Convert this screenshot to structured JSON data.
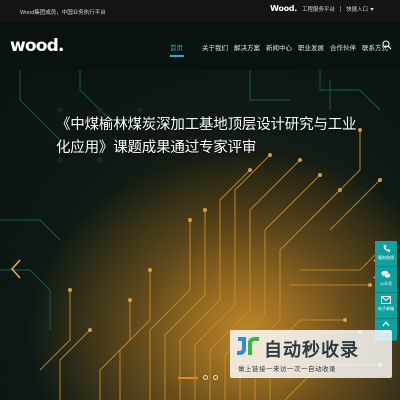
{
  "topbar": {
    "left_text": "Wood集团成员，中国业务执行平台",
    "mini_logo": "Wood.",
    "engineering_link": "工程服务平台",
    "quick_entry": "快捷入口"
  },
  "nav": {
    "logo": "wood.",
    "items": [
      {
        "label": "首页",
        "active": true
      },
      {
        "label": "关于我们",
        "active": false
      },
      {
        "label": "解决方案",
        "active": false
      },
      {
        "label": "新闻中心",
        "active": false
      },
      {
        "label": "职业发展",
        "active": false
      },
      {
        "label": "合作伙伴",
        "active": false
      },
      {
        "label": "联系方式",
        "active": false
      }
    ]
  },
  "hero": {
    "headline": "《中煤榆林煤炭深加工基地顶层设计研究与工业化应用》课题成果通过专家评审",
    "slide_count": 3,
    "active_slide": 1
  },
  "side_tools": {
    "items": [
      {
        "icon": "phone-icon",
        "label": "服务热线"
      },
      {
        "icon": "wechat-icon",
        "label": "公众号"
      },
      {
        "icon": "mail-icon",
        "label": "电子邮箱"
      },
      {
        "icon": "arrow-up-icon",
        "label": "TOP"
      }
    ]
  },
  "watermark": {
    "title": "自动秒收录",
    "subtitle": "做上链接一来访一次一自动收录"
  },
  "colors": {
    "accent": "#2fa8d8",
    "side_tools": "#11a0a0",
    "active_dot": "#e08a1e"
  }
}
